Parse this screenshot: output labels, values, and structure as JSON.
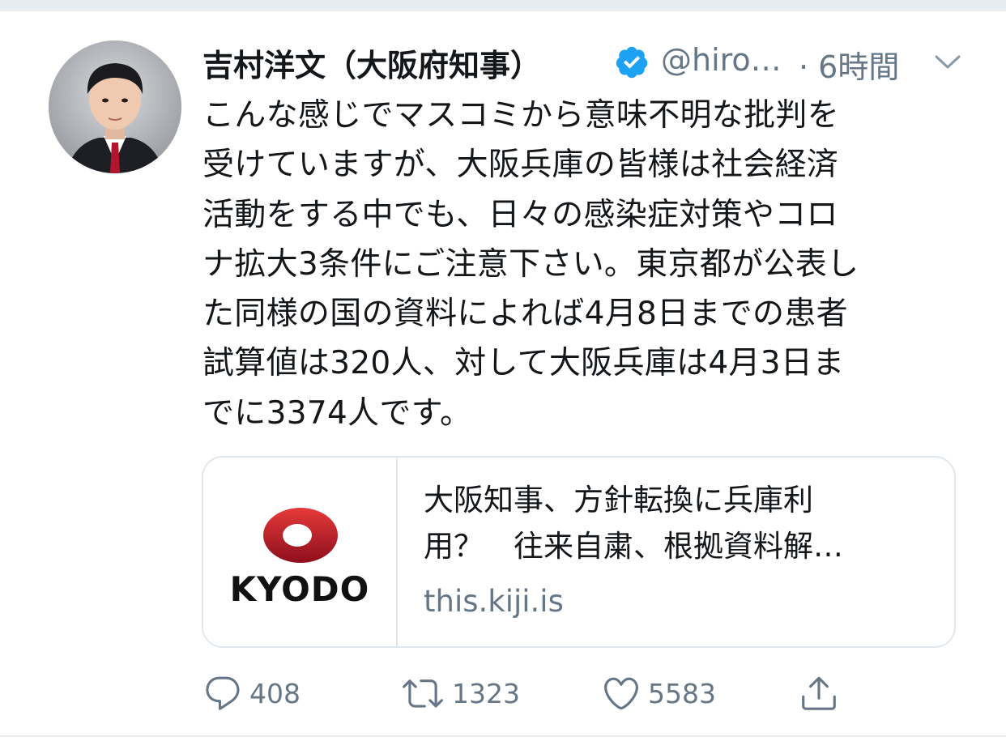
{
  "tweet": {
    "author": {
      "display_name": "吉村洋文（大阪府知事）",
      "handle": "@hiro…",
      "verified": true
    },
    "time": "· 6時間",
    "text": "こんな感じでマスコミから意味不明な批判を\n受けていますが、大阪兵庫の皆様は社会経済\n活動をする中でも、日々の感染症対策やコロ\nナ拡大3条件にご注意下さい。東京都が公表し\nた同様の国の資料によれば4月8日までの患者\n試算値は320人、対して大阪兵庫は4月3日ま\nでに3374人です。",
    "card": {
      "logo_text": "KYODO",
      "title_line1": "大阪知事、方針転換に兵庫利",
      "title_line2": "用？　往来自粛、根拠資料解…",
      "domain": "this.kiji.is"
    },
    "actions": {
      "reply_count": "408",
      "retweet_count": "1323",
      "like_count": "5583"
    }
  },
  "icons": {
    "verified": "verified-badge-icon",
    "chevron": "chevron-down-icon",
    "reply": "reply-icon",
    "retweet": "retweet-icon",
    "like": "heart-icon",
    "share": "share-icon"
  },
  "colors": {
    "text": "#14171a",
    "secondary": "#657786",
    "verified": "#1da1f2",
    "kyodo_red": "#c8102e",
    "border": "#e1e8ed"
  }
}
